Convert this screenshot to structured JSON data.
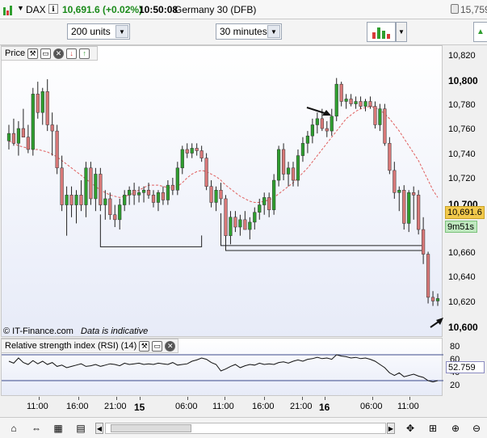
{
  "title": {
    "symbol": "DAX",
    "price": "10,691.6 (+0.02%)",
    "time": "10:50:08",
    "instrument": "Germany 30 (DFB)",
    "right_value": "15,759"
  },
  "controls": {
    "units": "200 units",
    "timeframe": "30 minutes"
  },
  "price_panel": {
    "label": "Price",
    "copyright": "© IT-Finance.com",
    "indicative": "Data is indicative",
    "current_price": "10,691.6",
    "countdown": "9m51s",
    "y_ticks": [
      {
        "label": "10,820",
        "bold": false
      },
      {
        "label": "10,800",
        "bold": true
      },
      {
        "label": "10,780",
        "bold": false
      },
      {
        "label": "10,760",
        "bold": false
      },
      {
        "label": "10,740",
        "bold": false
      },
      {
        "label": "10,720",
        "bold": false
      },
      {
        "label": "10,700",
        "bold": true
      },
      {
        "label": "10,680",
        "bold": false
      },
      {
        "label": "10,660",
        "bold": false
      },
      {
        "label": "10,640",
        "bold": false
      },
      {
        "label": "10,620",
        "bold": false
      },
      {
        "label": "10,600",
        "bold": true
      }
    ]
  },
  "rsi_panel": {
    "label": "Relative strength index (RSI) (14)",
    "value": "52.759",
    "y_ticks": [
      "80",
      "60",
      "40",
      "20"
    ]
  },
  "x_axis": {
    "ticks": [
      {
        "label": "11:00",
        "bold": false
      },
      {
        "label": "16:00",
        "bold": false
      },
      {
        "label": "21:00",
        "bold": false
      },
      {
        "label": "15",
        "bold": true
      },
      {
        "label": "06:00",
        "bold": false
      },
      {
        "label": "11:00",
        "bold": false
      },
      {
        "label": "16:00",
        "bold": false
      },
      {
        "label": "21:00",
        "bold": false
      },
      {
        "label": "16",
        "bold": true
      },
      {
        "label": "06:00",
        "bold": false
      },
      {
        "label": "11:00",
        "bold": false
      }
    ]
  },
  "chart_data": {
    "type": "candlestick",
    "ylim": [
      10600,
      10825
    ],
    "ma_color": "#e06060",
    "up_color": "#2f9e2f",
    "down_color": "#d87878",
    "candles": [
      {
        "o": 10752,
        "h": 10765,
        "l": 10745,
        "c": 10758
      },
      {
        "o": 10758,
        "h": 10770,
        "l": 10748,
        "c": 10750
      },
      {
        "o": 10750,
        "h": 10768,
        "l": 10740,
        "c": 10762
      },
      {
        "o": 10762,
        "h": 10778,
        "l": 10755,
        "c": 10755
      },
      {
        "o": 10755,
        "h": 10765,
        "l": 10742,
        "c": 10745
      },
      {
        "o": 10745,
        "h": 10795,
        "l": 10740,
        "c": 10790
      },
      {
        "o": 10790,
        "h": 10800,
        "l": 10770,
        "c": 10775
      },
      {
        "o": 10775,
        "h": 10795,
        "l": 10765,
        "c": 10792
      },
      {
        "o": 10792,
        "h": 10802,
        "l": 10760,
        "c": 10765
      },
      {
        "o": 10765,
        "h": 10775,
        "l": 10740,
        "c": 10760
      },
      {
        "o": 10760,
        "h": 10765,
        "l": 10725,
        "c": 10730
      },
      {
        "o": 10730,
        "h": 10740,
        "l": 10695,
        "c": 10700
      },
      {
        "o": 10700,
        "h": 10715,
        "l": 10675,
        "c": 10708
      },
      {
        "o": 10708,
        "h": 10715,
        "l": 10690,
        "c": 10700
      },
      {
        "o": 10700,
        "h": 10712,
        "l": 10685,
        "c": 10708
      },
      {
        "o": 10708,
        "h": 10720,
        "l": 10695,
        "c": 10700
      },
      {
        "o": 10700,
        "h": 10735,
        "l": 10690,
        "c": 10730
      },
      {
        "o": 10730,
        "h": 10735,
        "l": 10700,
        "c": 10705
      },
      {
        "o": 10705,
        "h": 10730,
        "l": 10695,
        "c": 10725
      },
      {
        "o": 10725,
        "h": 10730,
        "l": 10695,
        "c": 10700
      },
      {
        "o": 10700,
        "h": 10712,
        "l": 10688,
        "c": 10705
      },
      {
        "o": 10705,
        "h": 10710,
        "l": 10688,
        "c": 10692
      },
      {
        "o": 10692,
        "h": 10700,
        "l": 10682,
        "c": 10688
      },
      {
        "o": 10688,
        "h": 10705,
        "l": 10680,
        "c": 10700
      },
      {
        "o": 10700,
        "h": 10712,
        "l": 10695,
        "c": 10708
      },
      {
        "o": 10708,
        "h": 10715,
        "l": 10700,
        "c": 10712
      },
      {
        "o": 10712,
        "h": 10718,
        "l": 10700,
        "c": 10708
      },
      {
        "o": 10708,
        "h": 10715,
        "l": 10702,
        "c": 10710
      },
      {
        "o": 10710,
        "h": 10715,
        "l": 10702,
        "c": 10712
      },
      {
        "o": 10712,
        "h": 10718,
        "l": 10705,
        "c": 10708
      },
      {
        "o": 10708,
        "h": 10712,
        "l": 10698,
        "c": 10702
      },
      {
        "o": 10702,
        "h": 10712,
        "l": 10695,
        "c": 10710
      },
      {
        "o": 10710,
        "h": 10715,
        "l": 10700,
        "c": 10704
      },
      {
        "o": 10704,
        "h": 10720,
        "l": 10700,
        "c": 10716
      },
      {
        "o": 10716,
        "h": 10722,
        "l": 10708,
        "c": 10712
      },
      {
        "o": 10712,
        "h": 10735,
        "l": 10708,
        "c": 10730
      },
      {
        "o": 10730,
        "h": 10748,
        "l": 10725,
        "c": 10745
      },
      {
        "o": 10745,
        "h": 10750,
        "l": 10738,
        "c": 10742
      },
      {
        "o": 10742,
        "h": 10750,
        "l": 10738,
        "c": 10746
      },
      {
        "o": 10746,
        "h": 10750,
        "l": 10740,
        "c": 10744
      },
      {
        "o": 10744,
        "h": 10748,
        "l": 10735,
        "c": 10738
      },
      {
        "o": 10738,
        "h": 10742,
        "l": 10712,
        "c": 10715
      },
      {
        "o": 10715,
        "h": 10720,
        "l": 10698,
        "c": 10702
      },
      {
        "o": 10702,
        "h": 10715,
        "l": 10695,
        "c": 10712
      },
      {
        "o": 10712,
        "h": 10718,
        "l": 10700,
        "c": 10705
      },
      {
        "o": 10705,
        "h": 10708,
        "l": 10670,
        "c": 10675
      },
      {
        "o": 10675,
        "h": 10695,
        "l": 10668,
        "c": 10690
      },
      {
        "o": 10690,
        "h": 10695,
        "l": 10678,
        "c": 10682
      },
      {
        "o": 10682,
        "h": 10692,
        "l": 10675,
        "c": 10688
      },
      {
        "o": 10688,
        "h": 10695,
        "l": 10680,
        "c": 10680
      },
      {
        "o": 10680,
        "h": 10690,
        "l": 10672,
        "c": 10686
      },
      {
        "o": 10686,
        "h": 10698,
        "l": 10680,
        "c": 10694
      },
      {
        "o": 10694,
        "h": 10705,
        "l": 10688,
        "c": 10700
      },
      {
        "o": 10700,
        "h": 10710,
        "l": 10692,
        "c": 10706
      },
      {
        "o": 10706,
        "h": 10710,
        "l": 10690,
        "c": 10696
      },
      {
        "o": 10696,
        "h": 10725,
        "l": 10692,
        "c": 10720
      },
      {
        "o": 10720,
        "h": 10748,
        "l": 10715,
        "c": 10745
      },
      {
        "o": 10745,
        "h": 10750,
        "l": 10720,
        "c": 10725
      },
      {
        "o": 10725,
        "h": 10735,
        "l": 10715,
        "c": 10730
      },
      {
        "o": 10730,
        "h": 10735,
        "l": 10715,
        "c": 10720
      },
      {
        "o": 10720,
        "h": 10745,
        "l": 10715,
        "c": 10740
      },
      {
        "o": 10740,
        "h": 10755,
        "l": 10735,
        "c": 10750
      },
      {
        "o": 10750,
        "h": 10760,
        "l": 10742,
        "c": 10756
      },
      {
        "o": 10756,
        "h": 10770,
        "l": 10750,
        "c": 10765
      },
      {
        "o": 10765,
        "h": 10775,
        "l": 10758,
        "c": 10770
      },
      {
        "o": 10770,
        "h": 10778,
        "l": 10760,
        "c": 10762
      },
      {
        "o": 10762,
        "h": 10768,
        "l": 10755,
        "c": 10760
      },
      {
        "o": 10760,
        "h": 10778,
        "l": 10756,
        "c": 10772
      },
      {
        "o": 10772,
        "h": 10803,
        "l": 10768,
        "c": 10798
      },
      {
        "o": 10798,
        "h": 10800,
        "l": 10780,
        "c": 10784
      },
      {
        "o": 10784,
        "h": 10790,
        "l": 10778,
        "c": 10786
      },
      {
        "o": 10786,
        "h": 10790,
        "l": 10780,
        "c": 10782
      },
      {
        "o": 10782,
        "h": 10788,
        "l": 10778,
        "c": 10784
      },
      {
        "o": 10784,
        "h": 10788,
        "l": 10778,
        "c": 10780
      },
      {
        "o": 10780,
        "h": 10786,
        "l": 10776,
        "c": 10784
      },
      {
        "o": 10784,
        "h": 10788,
        "l": 10778,
        "c": 10780
      },
      {
        "o": 10780,
        "h": 10784,
        "l": 10762,
        "c": 10765
      },
      {
        "o": 10765,
        "h": 10782,
        "l": 10760,
        "c": 10778
      },
      {
        "o": 10778,
        "h": 10782,
        "l": 10748,
        "c": 10750
      },
      {
        "o": 10750,
        "h": 10755,
        "l": 10725,
        "c": 10728
      },
      {
        "o": 10728,
        "h": 10735,
        "l": 10705,
        "c": 10710
      },
      {
        "o": 10710,
        "h": 10715,
        "l": 10695,
        "c": 10712
      },
      {
        "o": 10712,
        "h": 10716,
        "l": 10680,
        "c": 10685
      },
      {
        "o": 10685,
        "h": 10712,
        "l": 10678,
        "c": 10710
      },
      {
        "o": 10710,
        "h": 10715,
        "l": 10688,
        "c": 10708
      },
      {
        "o": 10708,
        "h": 10712,
        "l": 10676,
        "c": 10680
      },
      {
        "o": 10680,
        "h": 10690,
        "l": 10652,
        "c": 10660
      },
      {
        "o": 10660,
        "h": 10662,
        "l": 10620,
        "c": 10625
      },
      {
        "o": 10625,
        "h": 10630,
        "l": 10618,
        "c": 10622
      },
      {
        "o": 10622,
        "h": 10628,
        "l": 10618,
        "c": 10624
      }
    ],
    "ma": [
      10752,
      10750,
      10748,
      10747,
      10746,
      10745,
      10745,
      10744,
      10743,
      10741,
      10739,
      10736,
      10733,
      10730,
      10727,
      10724,
      10721,
      10718,
      10715,
      10712,
      10710,
      10708,
      10707,
      10706,
      10707,
      10708,
      10710,
      10712,
      10714,
      10716,
      10716,
      10716,
      10715,
      10714,
      10714,
      10715,
      10718,
      10722,
      10725,
      10727,
      10728,
      10727,
      10725,
      10723,
      10720,
      10716,
      10713,
      10710,
      10707,
      10705,
      10703,
      10702,
      10702,
      10703,
      10704,
      10706,
      10709,
      10712,
      10715,
      10718,
      10722,
      10726,
      10730,
      10735,
      10740,
      10745,
      10750,
      10755,
      10760,
      10765,
      10770,
      10773,
      10776,
      10778,
      10779,
      10780,
      10779,
      10777,
      10774,
      10770,
      10765,
      10760,
      10754,
      10748,
      10742,
      10736,
      10728,
      10720,
      10712,
      10706
    ],
    "support_lines": [
      {
        "x1": 19,
        "x2": 40,
        "y": 10666
      },
      {
        "x1": 44,
        "x2": 86,
        "y": 10667
      },
      {
        "x1": 45,
        "x2": 86,
        "y": 10663
      }
    ],
    "rsi": [
      60,
      57,
      65,
      58,
      55,
      61,
      56,
      60,
      55,
      58,
      52,
      54,
      50,
      52,
      54,
      56,
      52,
      53,
      55,
      52,
      54,
      56,
      55,
      53,
      57,
      55,
      56,
      57,
      55,
      56,
      55,
      57,
      56,
      55,
      58,
      54,
      55,
      56,
      60,
      62,
      65,
      63,
      58,
      55,
      45,
      48,
      52,
      55,
      50,
      53,
      55,
      54,
      57,
      55,
      56,
      55,
      58,
      59,
      57,
      60,
      62,
      60,
      63,
      64,
      66,
      64,
      65,
      63,
      70,
      68,
      67,
      65,
      66,
      64,
      65,
      63,
      60,
      55,
      50,
      42,
      38,
      42,
      36,
      38,
      40,
      37,
      35,
      30,
      28,
      30
    ]
  }
}
